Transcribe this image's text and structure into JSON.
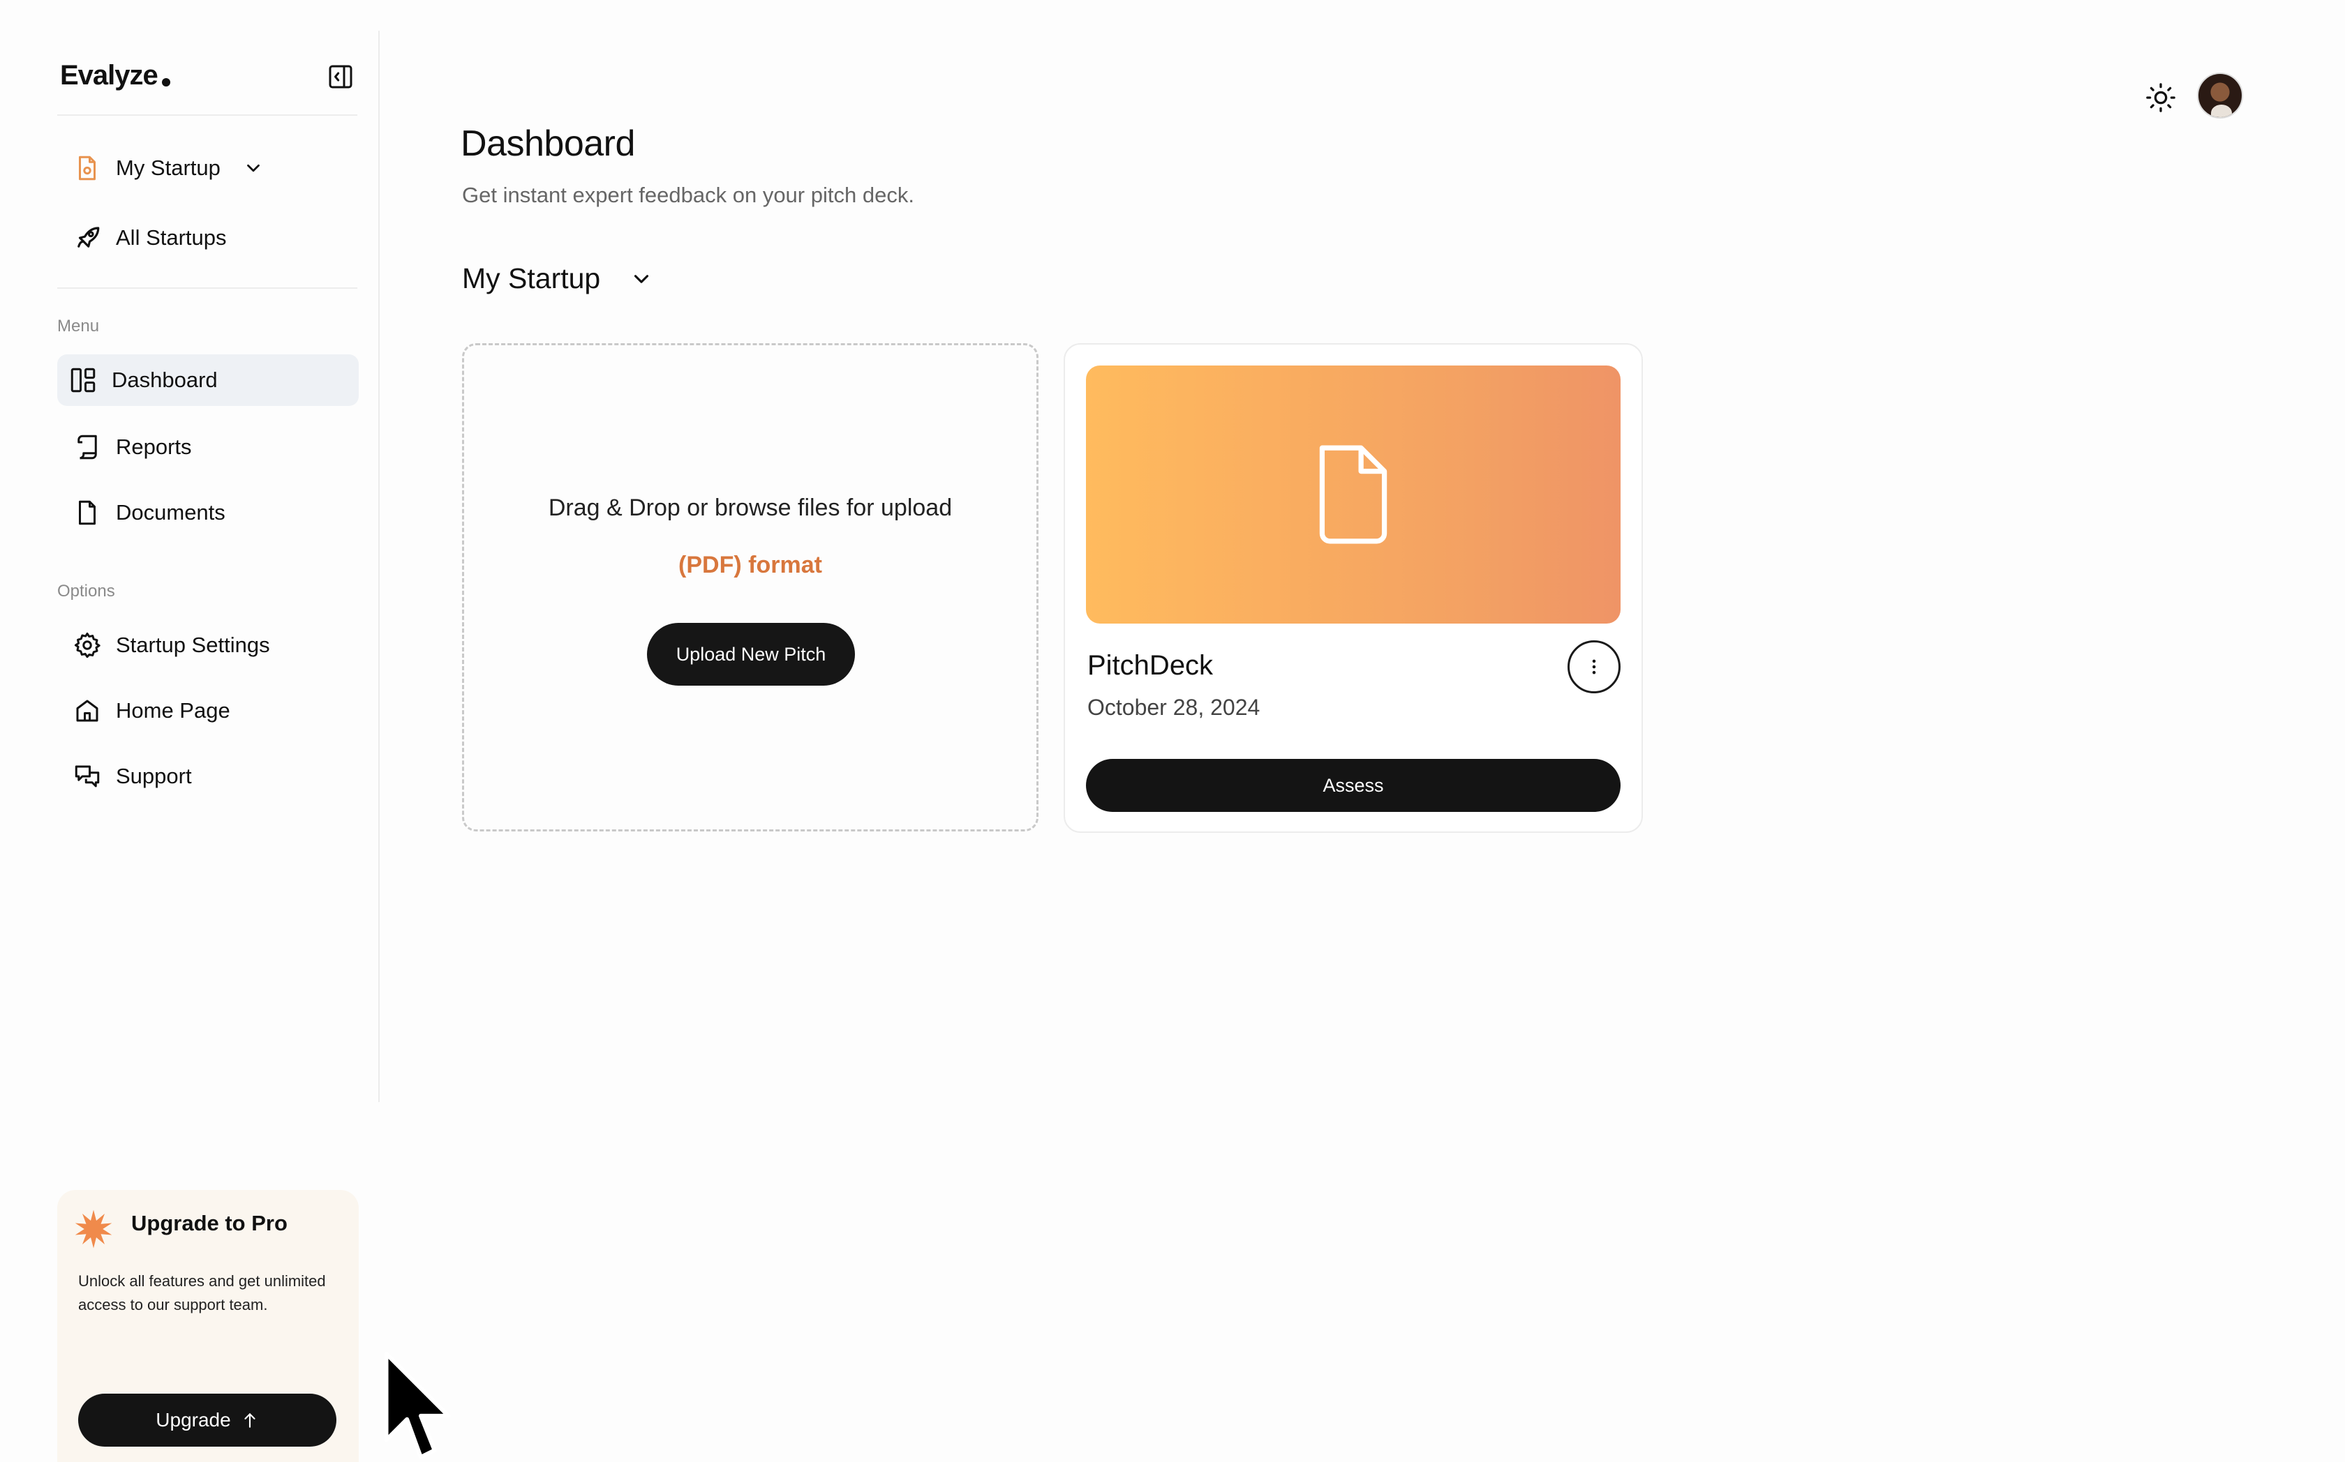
{
  "app": {
    "brand": "Evalyze"
  },
  "sidebar": {
    "startup_switch": {
      "label": "My Startup"
    },
    "all_startups": {
      "label": "All Startups"
    },
    "menu_label": "Menu",
    "menu_items": [
      {
        "label": "Dashboard",
        "icon": "dashboard-icon",
        "active": true
      },
      {
        "label": "Reports",
        "icon": "scroll-icon",
        "active": false
      },
      {
        "label": "Documents",
        "icon": "document-icon",
        "active": false
      }
    ],
    "options_label": "Options",
    "option_items": [
      {
        "label": "Startup Settings",
        "icon": "gear-icon"
      },
      {
        "label": "Home Page",
        "icon": "home-icon"
      },
      {
        "label": "Support",
        "icon": "chat-icon"
      }
    ],
    "promo": {
      "title": "Upgrade to Pro",
      "text": "Unlock all features and get unlimited access to our support team.",
      "button_label": "Upgrade"
    }
  },
  "main": {
    "title": "Dashboard",
    "subtitle": "Get instant expert feedback on your pitch deck.",
    "startup_select": {
      "value": "My Startup"
    },
    "upload": {
      "text": "Drag & Drop or browse files for upload",
      "format": "(PDF) format",
      "button_label": "Upload New Pitch"
    },
    "decks": [
      {
        "name": "PitchDeck",
        "date": "October 28, 2024",
        "action_label": "Assess"
      }
    ]
  },
  "colors": {
    "accent": "#d8773d",
    "thumb_start": "#ffbb5e",
    "thumb_end": "#ef9466",
    "active_bg": "#eef1f5",
    "button_dark": "#141414"
  }
}
